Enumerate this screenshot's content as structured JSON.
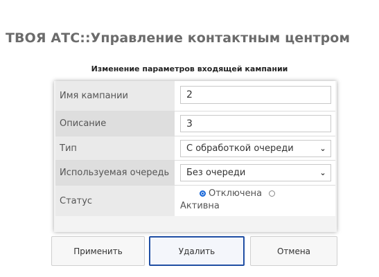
{
  "header": {
    "app_title": "ТВОЯ АТС::Управление контактным центром",
    "form_title": "Изменение параметров входящей кампании"
  },
  "form": {
    "name_label": "Имя кампании",
    "name_value": "2",
    "description_label": "Описание",
    "description_value": "3",
    "type_label": "Тип",
    "type_value": "С обработкой очереди",
    "queue_label": "Используемая очередь",
    "queue_value": "Без очереди",
    "status_label": "Статус",
    "status_options": [
      "Отключена",
      "Активна"
    ],
    "status_selected": "Отключена"
  },
  "buttons": {
    "apply": "Применить",
    "delete": "Удалить",
    "cancel": "Отмена"
  },
  "colors": {
    "title_gray": "#6b6b6b",
    "radio_blue": "#1565d8",
    "focus_border": "#1f4ea3"
  },
  "icons": {
    "dropdown": "chevron-down-icon",
    "radio_on": "radio-checked-icon",
    "radio_off": "radio-unchecked-icon"
  }
}
